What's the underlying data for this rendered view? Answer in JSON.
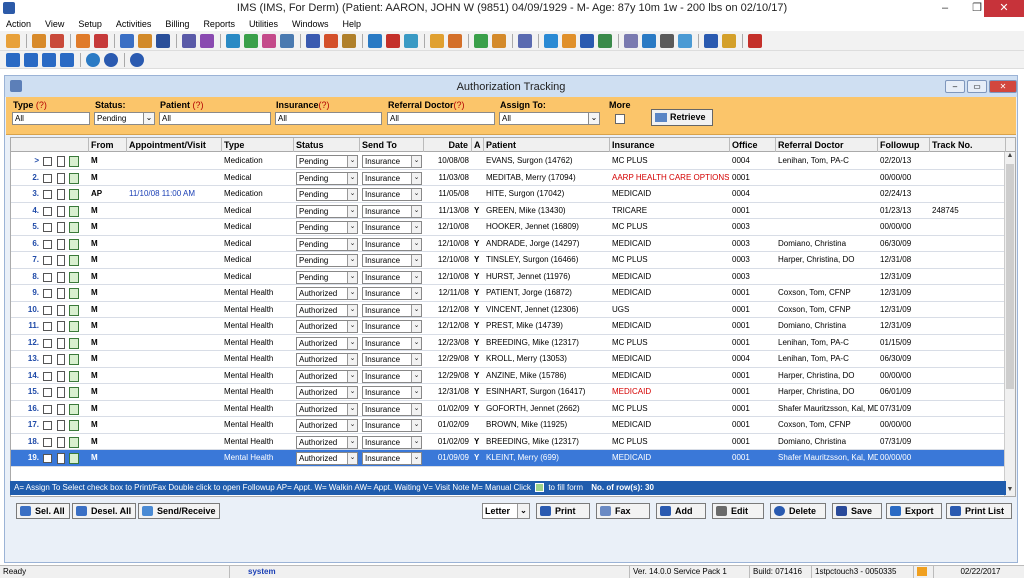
{
  "window": {
    "title": "IMS (IMS, For Derm)    (Patient: AARON, JOHN W (9851) 04/09/1929 - M- Age: 87y 10m 1w - 200 lbs on 02/10/17)",
    "minimize": "–",
    "maximize": "❐",
    "close": "✕"
  },
  "menu": [
    "Action",
    "View",
    "Setup",
    "Activities",
    "Billing",
    "Reports",
    "Utilities",
    "Windows",
    "Help"
  ],
  "subwindow": {
    "title": "Authorization Tracking"
  },
  "filters": {
    "type": {
      "label": "Type",
      "q": "(?)",
      "value": "All"
    },
    "status": {
      "label": "Status:",
      "value": "Pending"
    },
    "patient": {
      "label": "Patient",
      "q": "(?)",
      "value": "All"
    },
    "insurance": {
      "label": "Insurance",
      "q": "(?)",
      "value": "All"
    },
    "referral": {
      "label": "Referral Doctor",
      "q": "(?)",
      "value": "All"
    },
    "assign": {
      "label": "Assign To:",
      "value": "All"
    },
    "more": {
      "label": "More"
    },
    "retrieve": "Retrieve"
  },
  "grid": {
    "columns": [
      "From",
      "Appointment/Visit",
      "Type",
      "Status",
      "Send To",
      "Date",
      "A",
      "Patient",
      "Insurance",
      "Office",
      "Referral Doctor",
      "Followup",
      "Track No."
    ],
    "rows": [
      {
        "num": ">",
        "from": "M",
        "appt": "",
        "type": "Medication",
        "status": "Pending",
        "sendto": "Insurance",
        "date": "10/08/08",
        "a": "",
        "patient": "EVANS, Surgon  (14762)",
        "insurance": "MC PLUS",
        "ins_red": false,
        "office": "0004",
        "ref": "Lenihan, Tom, PA-C",
        "followup": "02/20/13",
        "track": ""
      },
      {
        "num": "2.",
        "from": "M",
        "appt": "",
        "type": "Medical",
        "status": "Pending",
        "sendto": "Insurance",
        "date": "11/03/08",
        "a": "",
        "patient": "MEDITAB, Merry  (17094)",
        "insurance": "AARP HEALTH CARE OPTIONS",
        "ins_red": true,
        "office": "0001",
        "ref": "",
        "followup": "00/00/00",
        "track": ""
      },
      {
        "num": "3.",
        "from": "AP",
        "appt": "11/10/08 11:00 AM",
        "type": "Medication",
        "status": "Pending",
        "sendto": "Insurance",
        "date": "11/05/08",
        "a": "",
        "patient": "HITE, Surgon  (17042)",
        "insurance": "MEDICAID",
        "ins_red": false,
        "office": "0004",
        "ref": "",
        "followup": "02/24/13",
        "track": ""
      },
      {
        "num": "4.",
        "from": "M",
        "appt": "",
        "type": "Medical",
        "status": "Pending",
        "sendto": "Insurance",
        "date": "11/13/08",
        "a": "Y",
        "patient": "GREEN, Mike  (13430)",
        "insurance": "TRICARE",
        "ins_red": false,
        "office": "0001",
        "ref": "",
        "followup": "01/23/13",
        "track": "248745"
      },
      {
        "num": "5.",
        "from": "M",
        "appt": "",
        "type": "Medical",
        "status": "Pending",
        "sendto": "Insurance",
        "date": "12/10/08",
        "a": "",
        "patient": "HOOKER, Jennet  (16809)",
        "insurance": "MC PLUS",
        "ins_red": false,
        "office": "0003",
        "ref": "",
        "followup": "00/00/00",
        "track": ""
      },
      {
        "num": "6.",
        "from": "M",
        "appt": "",
        "type": "Medical",
        "status": "Pending",
        "sendto": "Insurance",
        "date": "12/10/08",
        "a": "Y",
        "patient": "ANDRADE, Jorge  (14297)",
        "insurance": "MEDICAID",
        "ins_red": false,
        "office": "0003",
        "ref": "Domiano, Christina",
        "followup": "06/30/09",
        "track": ""
      },
      {
        "num": "7.",
        "from": "M",
        "appt": "",
        "type": "Medical",
        "status": "Pending",
        "sendto": "Insurance",
        "date": "12/10/08",
        "a": "Y",
        "patient": "TINSLEY, Surgon  (16466)",
        "insurance": "MC PLUS",
        "ins_red": false,
        "office": "0003",
        "ref": "Harper, Christina, DO",
        "followup": "12/31/08",
        "track": ""
      },
      {
        "num": "8.",
        "from": "M",
        "appt": "",
        "type": "Medical",
        "status": "Pending",
        "sendto": "Insurance",
        "date": "12/10/08",
        "a": "Y",
        "patient": "HURST, Jennet  (11976)",
        "insurance": "MEDICAID",
        "ins_red": false,
        "office": "0003",
        "ref": "",
        "followup": "12/31/09",
        "track": ""
      },
      {
        "num": "9.",
        "from": "M",
        "appt": "",
        "type": "Mental Health",
        "status": "Authorized",
        "sendto": "Insurance",
        "date": "12/11/08",
        "a": "Y",
        "patient": "PATIENT, Jorge  (16872)",
        "insurance": "MEDICAID",
        "ins_red": false,
        "office": "0001",
        "ref": "Coxson, Tom, CFNP",
        "followup": "12/31/09",
        "track": ""
      },
      {
        "num": "10.",
        "from": "M",
        "appt": "",
        "type": "Mental Health",
        "status": "Authorized",
        "sendto": "Insurance",
        "date": "12/12/08",
        "a": "Y",
        "patient": "VINCENT, Jennet  (12306)",
        "insurance": "UGS",
        "ins_red": false,
        "office": "0001",
        "ref": "Coxson, Tom, CFNP",
        "followup": "12/31/09",
        "track": ""
      },
      {
        "num": "11.",
        "from": "M",
        "appt": "",
        "type": "Mental Health",
        "status": "Authorized",
        "sendto": "Insurance",
        "date": "12/12/08",
        "a": "Y",
        "patient": "PREST, Mike  (14739)",
        "insurance": "MEDICAID",
        "ins_red": false,
        "office": "0001",
        "ref": "Domiano, Christina",
        "followup": "12/31/09",
        "track": ""
      },
      {
        "num": "12.",
        "from": "M",
        "appt": "",
        "type": "Mental Health",
        "status": "Authorized",
        "sendto": "Insurance",
        "date": "12/23/08",
        "a": "Y",
        "patient": "BREEDING, Mike  (12317)",
        "insurance": "MC PLUS",
        "ins_red": false,
        "office": "0001",
        "ref": "Lenihan, Tom, PA-C",
        "followup": "01/15/09",
        "track": ""
      },
      {
        "num": "13.",
        "from": "M",
        "appt": "",
        "type": "Mental Health",
        "status": "Authorized",
        "sendto": "Insurance",
        "date": "12/29/08",
        "a": "Y",
        "patient": "KROLL, Merry  (13053)",
        "insurance": "MEDICAID",
        "ins_red": false,
        "office": "0004",
        "ref": "Lenihan, Tom, PA-C",
        "followup": "06/30/09",
        "track": ""
      },
      {
        "num": "14.",
        "from": "M",
        "appt": "",
        "type": "Mental Health",
        "status": "Authorized",
        "sendto": "Insurance",
        "date": "12/29/08",
        "a": "Y",
        "patient": "ANZINE, Mike  (15786)",
        "insurance": "MEDICAID",
        "ins_red": false,
        "office": "0001",
        "ref": "Harper, Christina, DO",
        "followup": "00/00/00",
        "track": ""
      },
      {
        "num": "15.",
        "from": "M",
        "appt": "",
        "type": "Mental Health",
        "status": "Authorized",
        "sendto": "Insurance",
        "date": "12/31/08",
        "a": "Y",
        "patient": "ESINHART, Surgon  (16417)",
        "insurance": "MEDICAID",
        "ins_red": true,
        "office": "0001",
        "ref": "Harper, Christina, DO",
        "followup": "06/01/09",
        "track": ""
      },
      {
        "num": "16.",
        "from": "M",
        "appt": "",
        "type": "Mental Health",
        "status": "Authorized",
        "sendto": "Insurance",
        "date": "01/02/09",
        "a": "Y",
        "patient": "GOFORTH, Jennet  (2662)",
        "insurance": "MC PLUS",
        "ins_red": false,
        "office": "0001",
        "ref": "Shafer Mauritzsson, Kal, MD",
        "followup": "07/31/09",
        "track": ""
      },
      {
        "num": "17.",
        "from": "M",
        "appt": "",
        "type": "Mental Health",
        "status": "Authorized",
        "sendto": "Insurance",
        "date": "01/02/09",
        "a": "",
        "patient": "BROWN, Mike  (11925)",
        "insurance": "MEDICAID",
        "ins_red": false,
        "office": "0001",
        "ref": "Coxson, Tom, CFNP",
        "followup": "00/00/00",
        "track": ""
      },
      {
        "num": "18.",
        "from": "M",
        "appt": "",
        "type": "Mental Health",
        "status": "Authorized",
        "sendto": "Insurance",
        "date": "01/02/09",
        "a": "Y",
        "patient": "BREEDING, Mike  (12317)",
        "insurance": "MC PLUS",
        "ins_red": false,
        "office": "0001",
        "ref": "Domiano, Christina",
        "followup": "07/31/09",
        "track": ""
      },
      {
        "num": "19.",
        "from": "M",
        "appt": "",
        "type": "Mental Health",
        "status": "Authorized",
        "sendto": "Insurance",
        "date": "01/09/09",
        "a": "Y",
        "patient": "KLEINT, Merry  (699)",
        "insurance": "MEDICAID",
        "ins_red": false,
        "office": "0001",
        "ref": "Shafer Mauritzsson, Kal, MD",
        "followup": "00/00/00",
        "track": ""
      }
    ]
  },
  "legend": {
    "text": "A= Assign To    Select check box to Print/Fax    Double click to open Followup    AP= Appt. W= Walkin  AW= Appt. Waiting  V= Visit Note  M= Manual    Click",
    "fill": "to fill form",
    "count": "No. of row(s): 30"
  },
  "buttons": {
    "sel_all": "Sel. All",
    "desel_all": "Desel. All",
    "send_receive": "Send/Receive",
    "letter": "Letter",
    "print": "Print",
    "fax": "Fax",
    "add": "Add",
    "edit": "Edit",
    "delete": "Delete",
    "save": "Save",
    "export": "Export",
    "print_list": "Print List"
  },
  "status": {
    "ready": "Ready",
    "user": "system",
    "version": "Ver. 14.0.0 Service Pack 1",
    "build": "Build: 071416",
    "station": "1stpctouch3 - 0050335",
    "date": "02/22/2017"
  },
  "colors": {
    "filter_bg": "#fbc56a",
    "legend_bg": "#1f5cad",
    "selected_row": "#3a78d8",
    "accent_red": "#d40000"
  }
}
